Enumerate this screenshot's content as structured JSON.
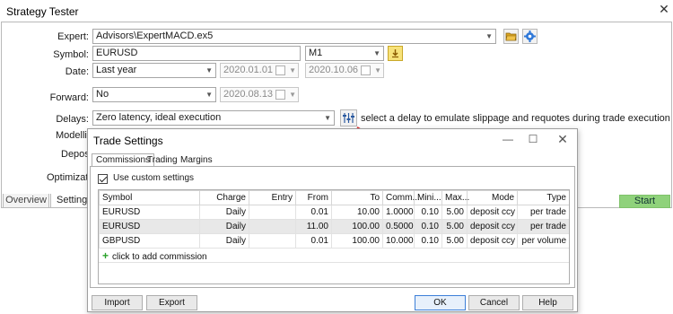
{
  "window": {
    "title": "Strategy Tester",
    "close_glyph": "✕"
  },
  "form": {
    "expert_label": "Expert:",
    "expert_value": "Advisors\\ExpertMACD.ex5",
    "symbol_label": "Symbol:",
    "symbol_value": "EURUSD",
    "timeframe_value": "M1",
    "date_label": "Date:",
    "date_value": "Last year",
    "date_from": "2020.01.01",
    "date_to": "2020.10.06",
    "forward_label": "Forward:",
    "forward_value": "No",
    "forward_date": "2020.08.13",
    "delays_label": "Delays:",
    "delays_value": "Zero latency, ideal execution",
    "delays_note": "select a delay to emulate slippage and requotes during trade execution",
    "modelling_label": "Modelling",
    "deposit_label": "Deposit",
    "optimization_label": "Optimization"
  },
  "bottom_tabs": [
    "Overview",
    "Settings"
  ],
  "start_label": "Start",
  "dialog": {
    "title": "Trade Settings",
    "tabs": [
      "Commissions",
      "Trading",
      "Margins"
    ],
    "use_custom_label": "Use custom settings",
    "columns": [
      "Symbol",
      "Charge",
      "Entry",
      "From",
      "To",
      "Comm...",
      "Mini...",
      "Max...",
      "Mode",
      "Type"
    ],
    "rows": [
      [
        "EURUSD",
        "Daily",
        "",
        "0.01",
        "10.00",
        "1.0000",
        "0.10",
        "5.00",
        "deposit ccy",
        "per trade"
      ],
      [
        "EURUSD",
        "Daily",
        "",
        "11.00",
        "100.00",
        "0.5000",
        "0.10",
        "5.00",
        "deposit ccy",
        "per trade"
      ],
      [
        "GBPUSD",
        "Daily",
        "",
        "0.01",
        "100.00",
        "10.0000",
        "0.10",
        "5.00",
        "deposit ccy",
        "per volume"
      ]
    ],
    "add_row_label": "click to add commission",
    "buttons": {
      "import": "Import",
      "export": "Export",
      "ok": "OK",
      "cancel": "Cancel",
      "help": "Help"
    }
  },
  "colors": {
    "start": "#8fd27b",
    "accent_arrow": "#e03030",
    "add_plus": "#2aa22a"
  },
  "icons": [
    "close-icon",
    "folder-icon",
    "gear-icon",
    "download-icon",
    "calendar-icon",
    "dropdown-arrow-icon",
    "delay-settings-icon",
    "red-arrow-icon",
    "plus-icon",
    "minimize-icon",
    "maximize-icon"
  ]
}
